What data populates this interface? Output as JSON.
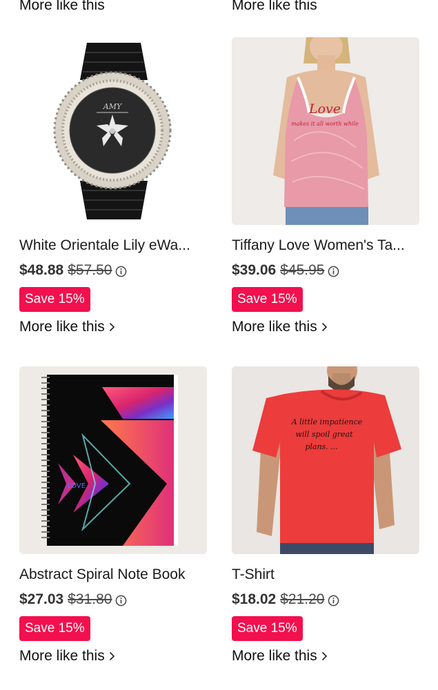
{
  "top_partial": {
    "more_left": "More like this",
    "more_right": "More like this"
  },
  "products": [
    {
      "title": "White Orientale Lily eWa...",
      "price": "$48.88",
      "old_price": "$57.50",
      "badge": "Save 15%",
      "more": "More like this",
      "image": "black-rhinestone-watch"
    },
    {
      "title": "Tiffany Love Women's Ta...",
      "price": "$39.06",
      "old_price": "$45.95",
      "badge": "Save 15%",
      "more": "More like this",
      "image": "pink-tank-top",
      "print": {
        "line1": "Love",
        "line2": "makes it all worth while"
      }
    },
    {
      "title": "Abstract Spiral Note Book",
      "price": "$27.03",
      "old_price": "$31.80",
      "badge": "Save 15%",
      "more": "More like this",
      "image": "spiral-notebook"
    },
    {
      "title": "T-Shirt",
      "price": "$18.02",
      "old_price": "$21.20",
      "badge": "Save 15%",
      "more": "More like this",
      "image": "red-tshirt",
      "print": {
        "line1": "A little impatience",
        "line2": "will spoil great",
        "line3": "plans. ..."
      }
    }
  ],
  "colors": {
    "badge_bg": "#f2104e",
    "badge_text": "#ffffff",
    "text": "#1a1a1a"
  }
}
